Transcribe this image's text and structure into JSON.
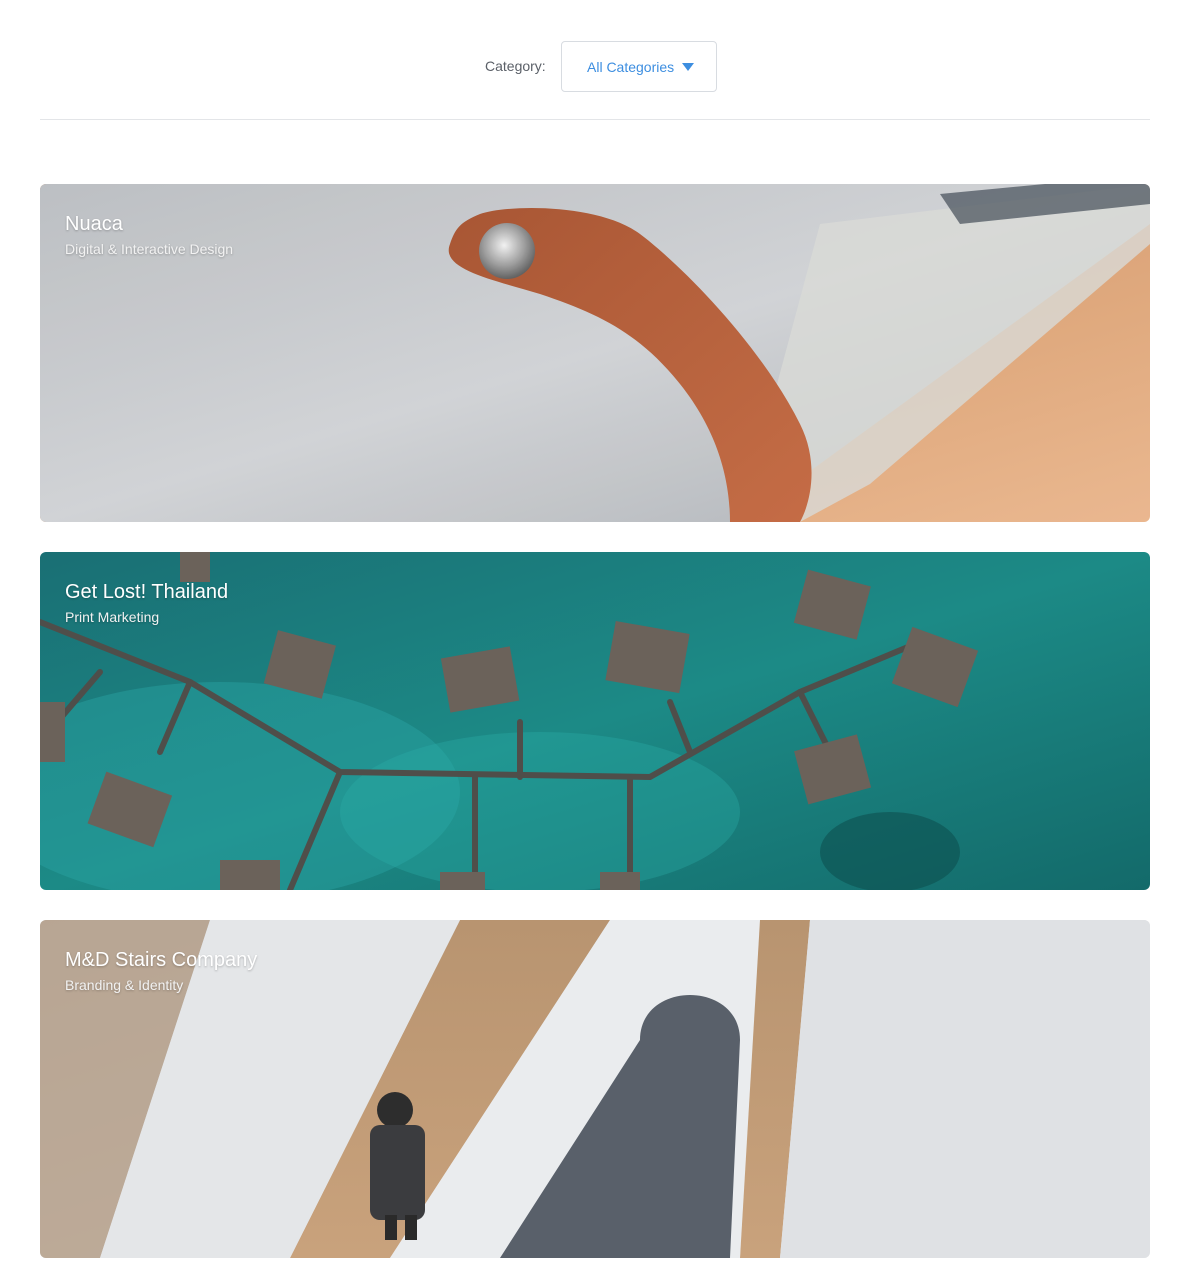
{
  "filter": {
    "label": "Category:",
    "selected": "All Categories"
  },
  "projects": [
    {
      "title": "Nuaca",
      "category": "Digital & Interactive Design"
    },
    {
      "title": "Get Lost! Thailand",
      "category": "Print Marketing"
    },
    {
      "title": "M&D Stairs Company",
      "category": "Branding & Identity"
    }
  ],
  "colors": {
    "accent": "#3d8ee0",
    "label": "#5b6068",
    "divider": "#e3e5e8"
  }
}
